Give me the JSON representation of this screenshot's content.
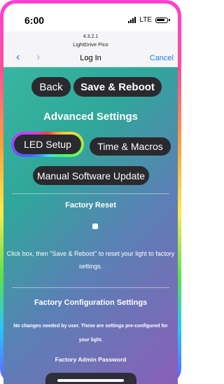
{
  "status_bar": {
    "time": "6:00",
    "carrier": "LTE"
  },
  "browser": {
    "version": "4.3.2.1",
    "site_name": "LightDrive Pico",
    "page_title": "Log In",
    "cancel_label": "Cancel",
    "back_icon": "chevron-left-icon",
    "forward_icon": "chevron-right-icon"
  },
  "toolbar": {
    "back_label": "Back",
    "save_label": "Save & Reboot"
  },
  "advanced": {
    "title": "Advanced Settings",
    "led_setup_label": "LED Setup",
    "time_macros_label": "Time & Macros",
    "manual_update_label": "Manual Software Update"
  },
  "factory_reset": {
    "title": "Factory Reset",
    "description": "Click box, then \"Save & Reboot\" to reset your light to factory settings."
  },
  "factory_config": {
    "title": "Factory Configuration Settings",
    "description": "No changes needed by user. These are settings pre-configured for your light.",
    "admin_password_label": "Factory Admin Password"
  },
  "colors": {
    "accent": "#1a7cf5",
    "pill": "#2a2a2e",
    "content_start": "#38b6a0",
    "content_end": "#8a5fb8"
  }
}
